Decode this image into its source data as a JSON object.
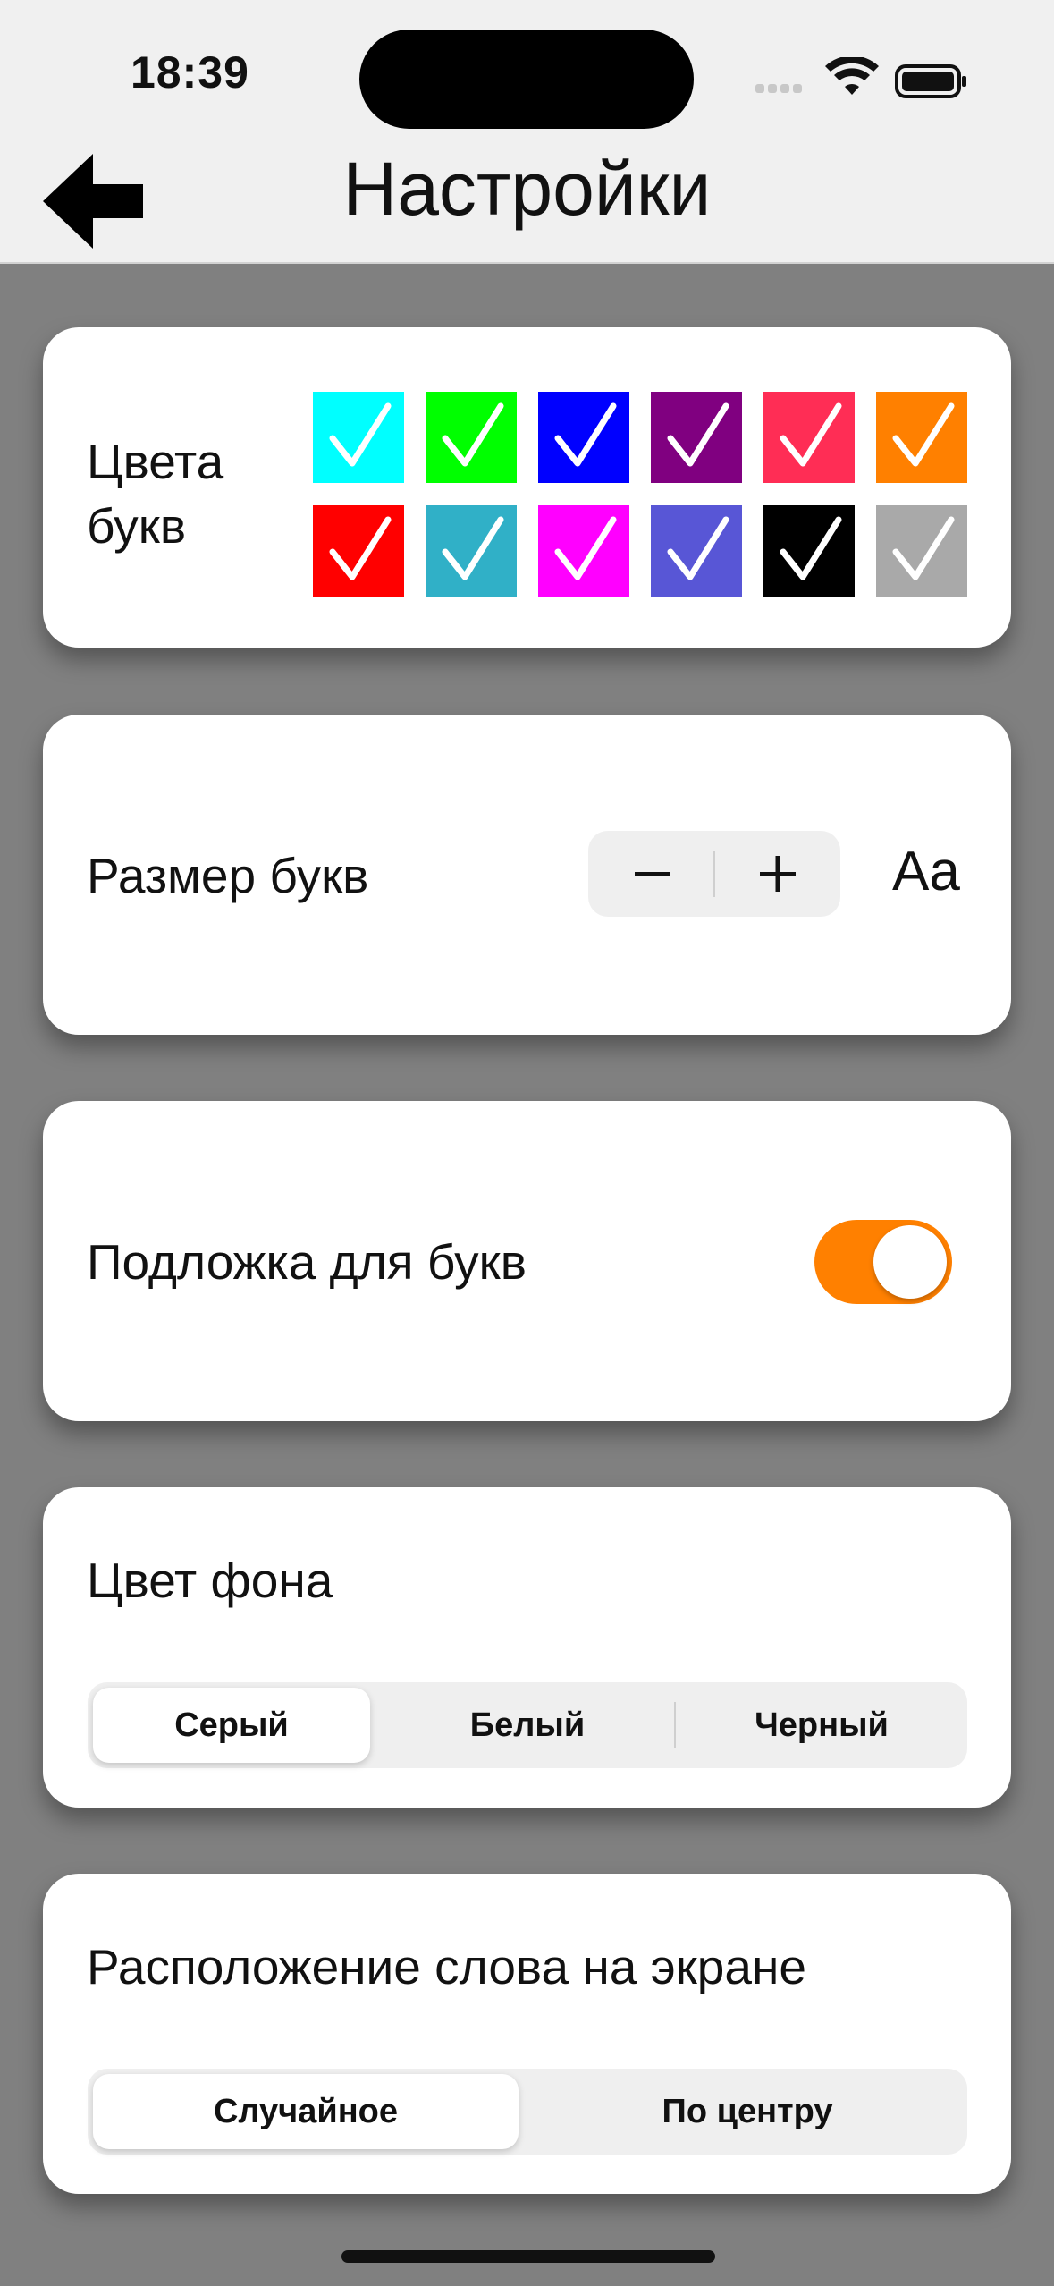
{
  "status_bar": {
    "time": "18:39"
  },
  "header": {
    "title": "Настройки",
    "back_icon": "arrow-left-icon"
  },
  "letter_colors": {
    "label": "Цвета букв",
    "swatches": [
      "#00ffff",
      "#00ff00",
      "#0000ff",
      "#800080",
      "#ff2d55",
      "#ff8000",
      "#ff0000",
      "#30b0c7",
      "#ff00ff",
      "#5856d6",
      "#000000",
      "#a9a9a9"
    ]
  },
  "letter_size": {
    "label": "Размер букв",
    "minus": "−",
    "plus": "+",
    "preview": "Aa"
  },
  "letter_backing": {
    "label": "Подложка для букв",
    "enabled": true,
    "color": "#ff8000"
  },
  "background_color": {
    "label": "Цвет фона",
    "options": [
      "Серый",
      "Белый",
      "Черный"
    ],
    "selected": "Серый"
  },
  "word_position": {
    "label": "Расположение слова на экране",
    "options": [
      "Случайное",
      "По центру"
    ],
    "selected": "Случайное"
  }
}
